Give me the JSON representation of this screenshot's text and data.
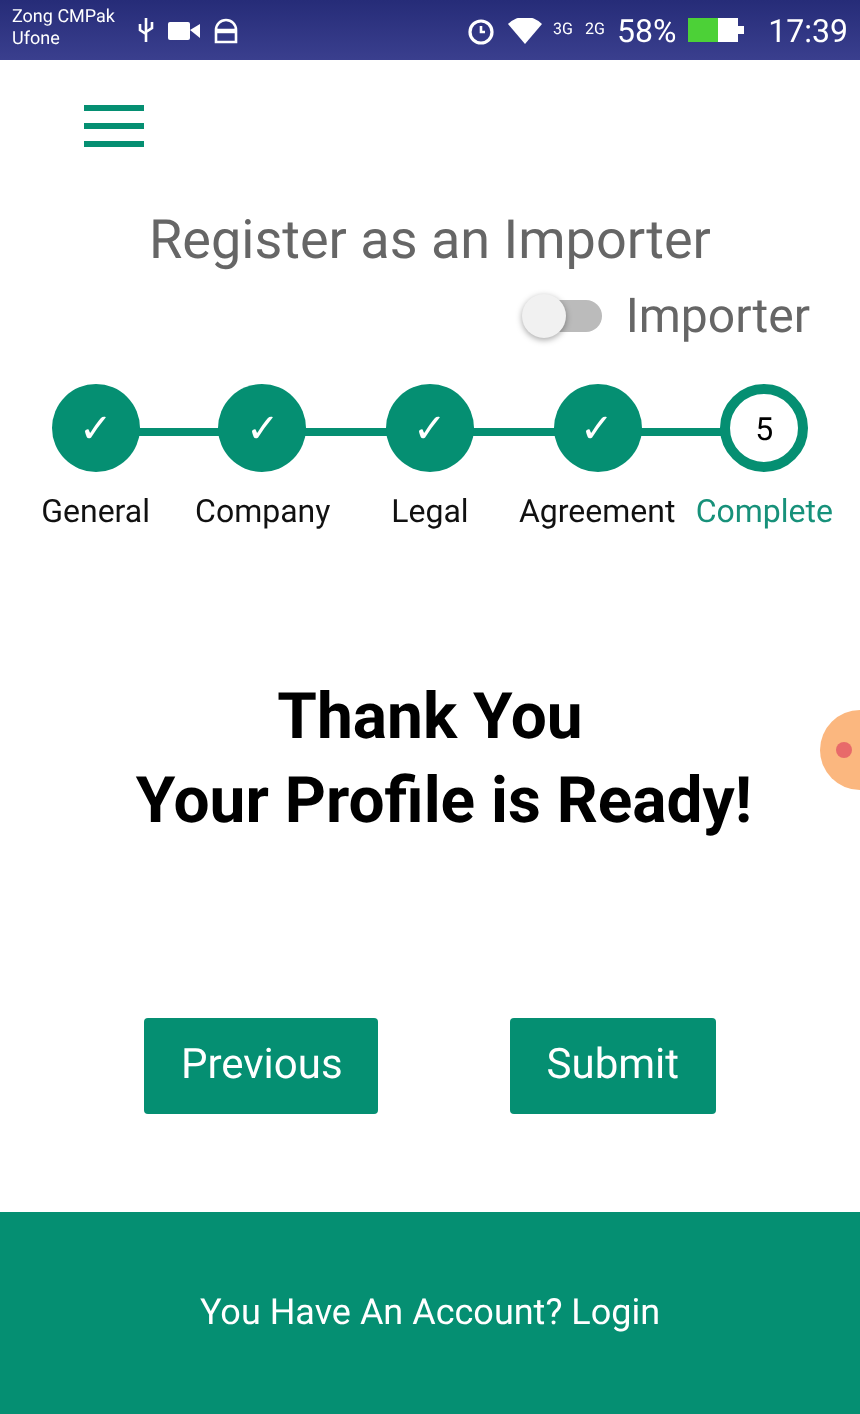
{
  "status_bar": {
    "carriers": [
      "Zong CMPak",
      "Ufone"
    ],
    "network_1": "3G",
    "network_2": "2G",
    "battery": "58%",
    "time": "17:39"
  },
  "title": "Register as an Importer",
  "importer_toggle": {
    "label": "Importer",
    "on": false
  },
  "steps": [
    {
      "kind": "done",
      "mark": "✓",
      "label": "General"
    },
    {
      "kind": "done",
      "mark": "✓",
      "label": "Company"
    },
    {
      "kind": "done",
      "mark": "✓",
      "label": "Legal"
    },
    {
      "kind": "done",
      "mark": "✓",
      "label": "Agreement"
    },
    {
      "kind": "current",
      "mark": "5",
      "label": "Complete"
    }
  ],
  "message": [
    "Thank You",
    "Your Profile is Ready!"
  ],
  "buttons": [
    "Previous",
    "Submit"
  ],
  "footer": "You Have An Account? Login"
}
